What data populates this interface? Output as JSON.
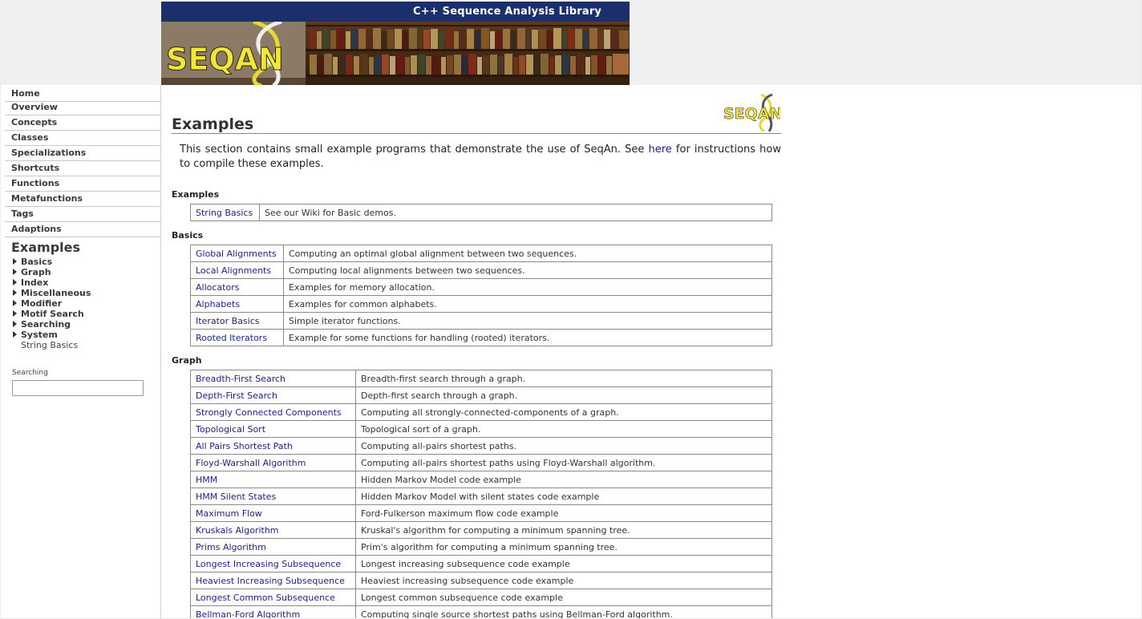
{
  "banner": {
    "title": "C++ Sequence Analysis Library",
    "logo_text": "SEQAN"
  },
  "small_logo_text": "SEQAN",
  "sidebar": {
    "nav": [
      "Home",
      "Overview",
      "Concepts",
      "Classes",
      "Specializations",
      "Shortcuts",
      "Functions",
      "Metafunctions",
      "Tags",
      "Adaptions"
    ],
    "current": "Examples",
    "sub": [
      "Basics",
      "Graph",
      "Index",
      "Miscellaneous",
      "Modifier",
      "Motif Search",
      "Searching",
      "System"
    ],
    "sub_plain": "String Basics",
    "search_label": "Searching",
    "search_value": ""
  },
  "main": {
    "title": "Examples",
    "intro_pre": "This section contains small example programs that demonstrate the use of SeqAn. See ",
    "intro_link": "here",
    "intro_post": " for instructions how to compile these examples.",
    "sections": [
      {
        "heading": "Examples",
        "rows": [
          [
            "String Basics",
            "See our Wiki for Basic demos."
          ]
        ]
      },
      {
        "heading": "Basics",
        "rows": [
          [
            "Global Alignments",
            "Computing an optimal global alignment between two sequences."
          ],
          [
            "Local Alignments",
            "Computing local alignments between two sequences."
          ],
          [
            "Allocators",
            "Examples for memory allocation."
          ],
          [
            "Alphabets",
            "Examples for common alphabets."
          ],
          [
            "Iterator Basics",
            "Simple iterator functions."
          ],
          [
            "Rooted Iterators",
            "Example for some functions for handling (rooted) iterators."
          ]
        ]
      },
      {
        "heading": "Graph",
        "rows": [
          [
            "Breadth-First Search",
            "Breadth-first search through a graph."
          ],
          [
            "Depth-First Search",
            "Depth-first search through a graph."
          ],
          [
            "Strongly Connected Components",
            "Computing all strongly-connected-components of a graph."
          ],
          [
            "Topological Sort",
            "Topological sort of a graph."
          ],
          [
            "All Pairs Shortest Path",
            "Computing all-pairs shortest paths."
          ],
          [
            "Floyd-Warshall Algorithm",
            "Computing all-pairs shortest paths using Floyd-Warshall algorithm."
          ],
          [
            "HMM",
            "Hidden Markov Model code example"
          ],
          [
            "HMM Silent States",
            "Hidden Markov Model with silent states code example"
          ],
          [
            "Maximum Flow",
            "Ford-Fulkerson maximum flow code example"
          ],
          [
            "Kruskals Algorithm",
            "Kruskal's algorithm for computing a minimum spanning tree."
          ],
          [
            "Prims Algorithm",
            "Prim's algorithm for computing a minimum spanning tree."
          ],
          [
            "Longest Increasing Subsequence",
            "Longest increasing subsequence code example"
          ],
          [
            "Heaviest Increasing Subsequence",
            "Heaviest increasing subsequence code example"
          ],
          [
            "Longest Common Subsequence",
            "Longest common subsequence code example"
          ],
          [
            "Bellman-Ford Algorithm",
            "Computing single source shortest paths using Bellman-Ford algorithm."
          ]
        ]
      }
    ]
  },
  "colors": {
    "link": "#1a1f8c",
    "banner_bar": "#1b2f6b",
    "logo_yellow": "#f3e53b"
  }
}
